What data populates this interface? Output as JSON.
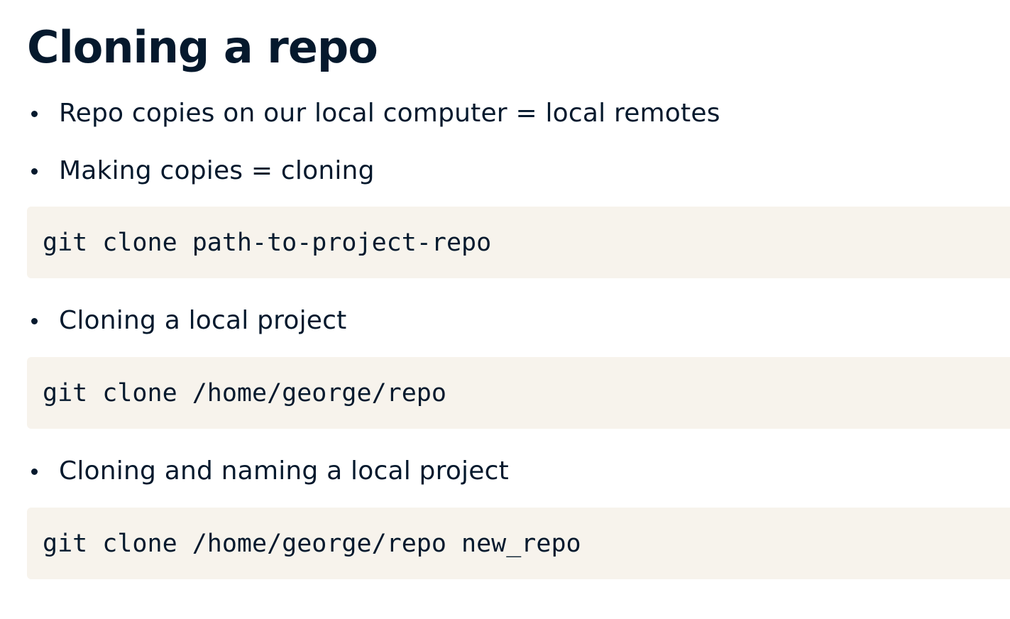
{
  "slide": {
    "title": "Cloning a repo",
    "bullets": [
      "Repo copies on our local computer = local remotes",
      "Making copies = cloning",
      "Cloning a local project",
      "Cloning and naming a local project"
    ],
    "code_blocks": [
      "git clone path-to-project-repo",
      "git clone /home/george/repo",
      "git clone /home/george/repo new_repo"
    ]
  }
}
